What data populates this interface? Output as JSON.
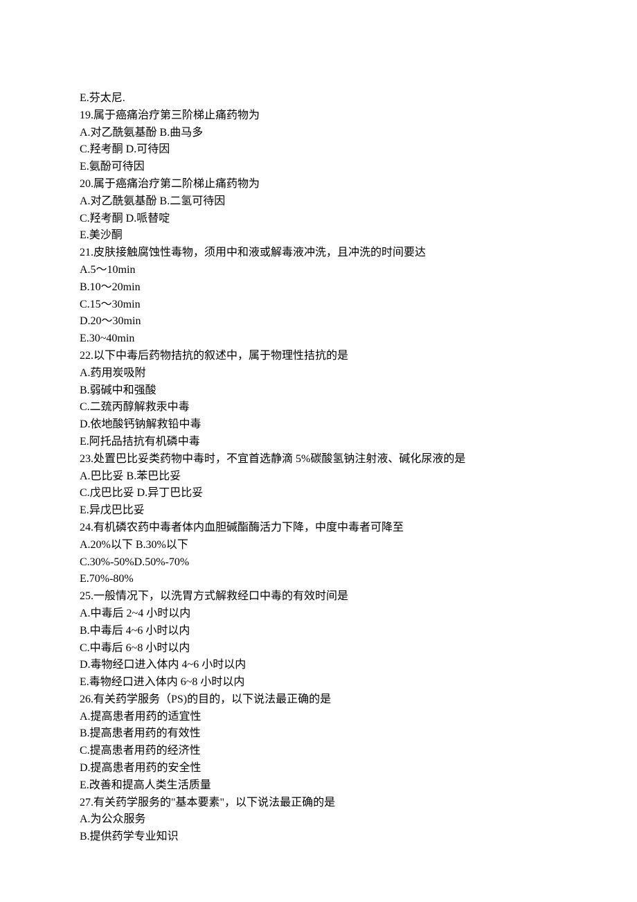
{
  "lines": [
    "E.芬太尼.",
    "19.属于癌痛治疗第三阶梯止痛药物为",
    "A.对乙酰氨基酚 B.曲马多",
    "C.羟考酮 D.可待因",
    "E.氨酚可待因",
    "20.属于癌痛治疗第二阶梯止痛药物为",
    "A.对乙酰氨基酚 B.二氢可待因",
    "C.羟考酮 D.哌替啶",
    "E.美沙酮",
    "21.皮肤接触腐蚀性毒物，须用中和液或解毒液冲洗，且冲洗的时间要达",
    "A.5～10min",
    "B.10～20min",
    "C.15～30min",
    "D.20～30min",
    "E.30~40min",
    "22.以下中毒后药物拮抗的叙述中，属于物理性拮抗的是",
    "A.药用炭吸附",
    "B.弱碱中和强酸",
    "C.二巯丙醇解救汞中毒",
    "D.依地酸钙钠解救铅中毒",
    "E.阿托品拮抗有机磷中毒",
    "23.处置巴比妥类药物中毒时，不宜首选静滴 5%碳酸氢钠注射液、碱化尿液的是",
    "A.巴比妥 B.苯巴比妥",
    "C.戊巴比妥 D.异丁巴比妥",
    "E.异戊巴比妥",
    "24.有机磷农药中毒者体内血胆碱酯酶活力下降，中度中毒者可降至",
    "A.20%以下 B.30%以下",
    "C.30%-50%D.50%-70%",
    "E.70%-80%",
    "25.一般情况下，以洗胃方式解救经口中毒的有效时间是",
    "A.中毒后 2~4 小时以内",
    "B.中毒后 4~6 小时以内",
    "C.中毒后 6~8 小时以内",
    "D.毒物经口进入体内 4~6 小时以内",
    "E.毒物经口进入体内 6~8 小时以内",
    "26.有关药学服务（PS)的目的，以下说法最正确的是",
    "A.提高患者用药的适宜性",
    "B.提高患者用药的有效性",
    "C.提高患者用药的经济性",
    "D.提高患者用药的安全性",
    "E.改善和提高人类生活质量",
    "27.有关药学服务的\"基本要素\"，以下说法最正确的是",
    "A.为公众服务",
    "B.提供药学专业知识"
  ]
}
